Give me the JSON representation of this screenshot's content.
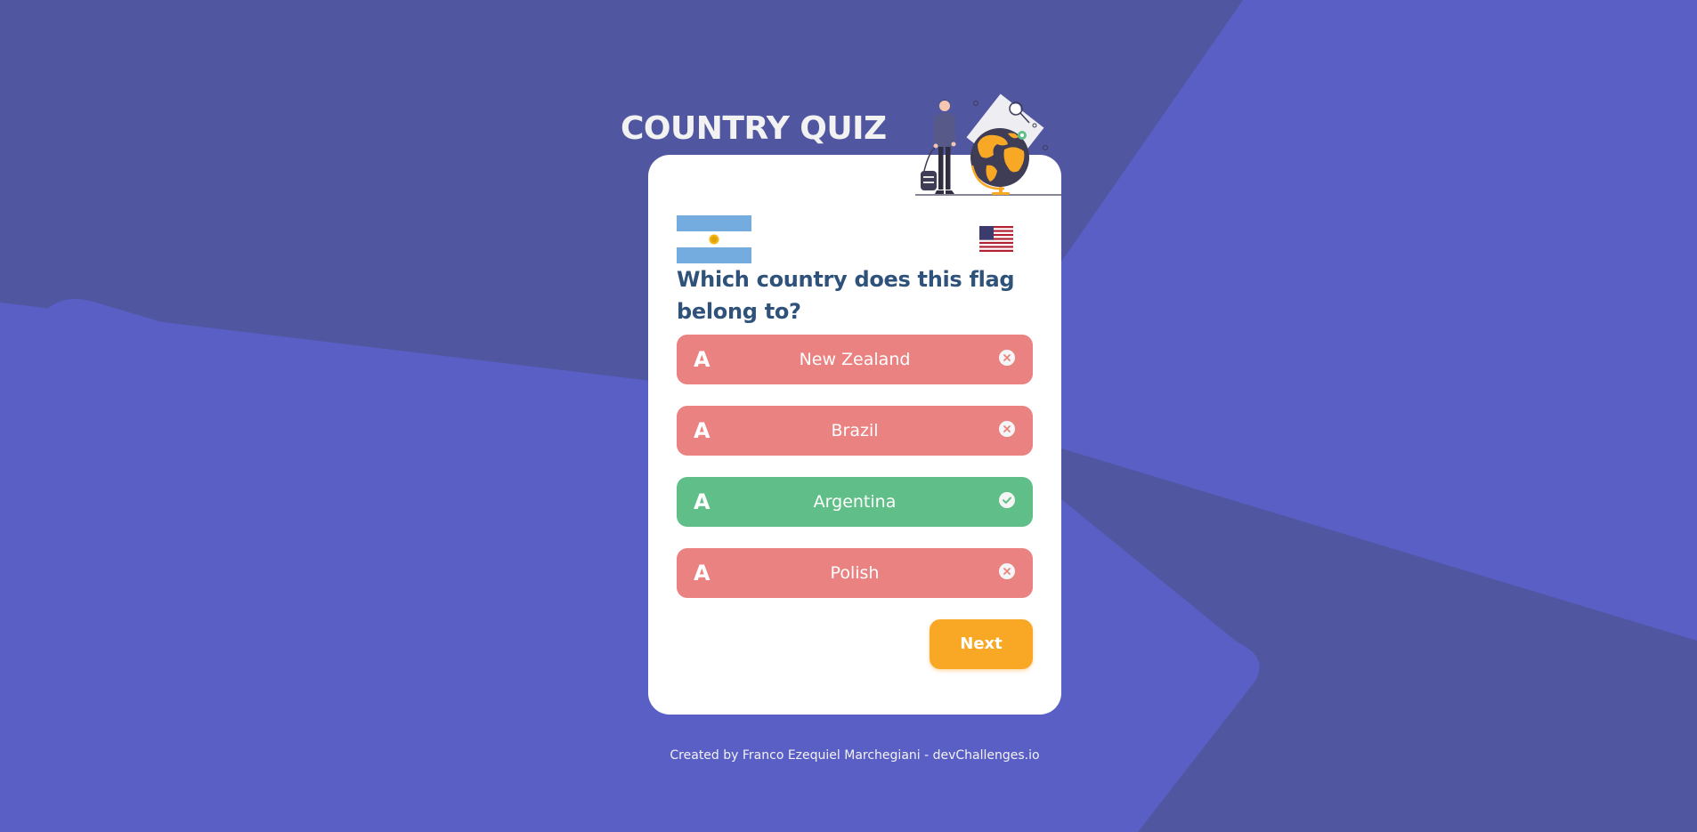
{
  "header": {
    "title": "COUNTRY QUIZ"
  },
  "quiz": {
    "flag_icon": "argentina-flag-icon",
    "secondary_flag_icon": "usa-flag-icon",
    "question": "Which country does this flag belong to?",
    "answers": [
      {
        "letter": "A",
        "label": "New Zealand",
        "status": "wrong",
        "status_icon": "close-circle-icon"
      },
      {
        "letter": "A",
        "label": "Brazil",
        "status": "wrong",
        "status_icon": "close-circle-icon"
      },
      {
        "letter": "A",
        "label": "Argentina",
        "status": "correct",
        "status_icon": "check-circle-icon"
      },
      {
        "letter": "A",
        "label": "Polish",
        "status": "wrong",
        "status_icon": "close-circle-icon"
      }
    ],
    "next_label": "Next"
  },
  "footer": {
    "credit": "Created by Franco Ezequiel Marchegiani - devChallenges.io"
  },
  "colors": {
    "background": "#5A5FC6",
    "background_shape": "#5057A0",
    "card": "#FFFFFF",
    "question_text": "#2F527B",
    "wrong": "#EA8282",
    "correct": "#60BF88",
    "next_button": "#F9A826"
  }
}
